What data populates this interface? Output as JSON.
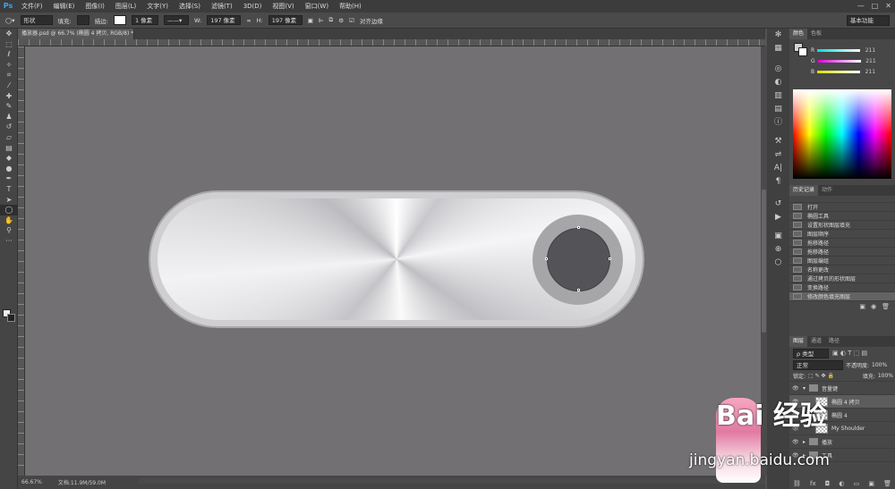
{
  "app": {
    "logo": "Ps"
  },
  "menu": [
    "文件(F)",
    "编辑(E)",
    "图像(I)",
    "图层(L)",
    "文字(Y)",
    "选择(S)",
    "滤镜(T)",
    "3D(D)",
    "视图(V)",
    "窗口(W)",
    "帮助(H)"
  ],
  "window_controls": {
    "min": "—",
    "max": "□",
    "close": "✕"
  },
  "options": {
    "mode": "形状",
    "fill_label": "填充:",
    "stroke_label": "描边:",
    "stroke_width": "1 像素",
    "w_label": "W:",
    "w_value": "197 像素",
    "link_icon": "∞",
    "h_label": "H:",
    "h_value": "197 像素",
    "align_label": "对齐边缘",
    "workspace": "基本功能"
  },
  "document": {
    "tab_title": "播放器.psd @ 66.7% (椭圆 4 拷贝, RGB/8) *"
  },
  "status": {
    "zoom": "66.67%",
    "doc_info": "文档:11.9M/59.0M"
  },
  "color_panel": {
    "tabs": [
      "颜色",
      "色板"
    ],
    "rows": [
      {
        "label": "R",
        "value": "211",
        "color": "#d3d3d3"
      },
      {
        "label": "G",
        "value": "211",
        "color": "#d3d3d3"
      },
      {
        "label": "B",
        "value": "211",
        "color": "#d3d3d3"
      }
    ]
  },
  "history_panel": {
    "tabs": [
      "历史记录",
      "动作"
    ],
    "items": [
      "打开",
      "椭圆工具",
      "设置形状图层填充",
      "图层顺序",
      "拖移路径",
      "拖移路径",
      "图层编组",
      "名称更改",
      "通过拷贝的形状图层",
      "变换路径",
      "修改颜色填充图层"
    ]
  },
  "layers_panel": {
    "tabs": [
      "图层",
      "通道",
      "路径"
    ],
    "filter_label": "ρ 类型",
    "blend_mode": "正常",
    "opacity_label": "不透明度:",
    "opacity_value": "100%",
    "lock_label": "锁定:",
    "fill_label": "填充:",
    "fill_value": "100%",
    "layers": [
      {
        "name": "音量键",
        "type": "group",
        "selected": false
      },
      {
        "name": "椭圆 4 拷贝",
        "type": "shape",
        "selected": true
      },
      {
        "name": "椭圆 4",
        "type": "shape",
        "selected": false
      },
      {
        "name": "My Shoulder",
        "type": "text",
        "selected": false
      },
      {
        "name": "播放",
        "type": "group",
        "selected": false
      },
      {
        "name": "工具",
        "type": "group",
        "selected": false
      }
    ]
  },
  "watermark": {
    "brand": "Bai 经验",
    "url": "jingyan.baidu.com"
  }
}
